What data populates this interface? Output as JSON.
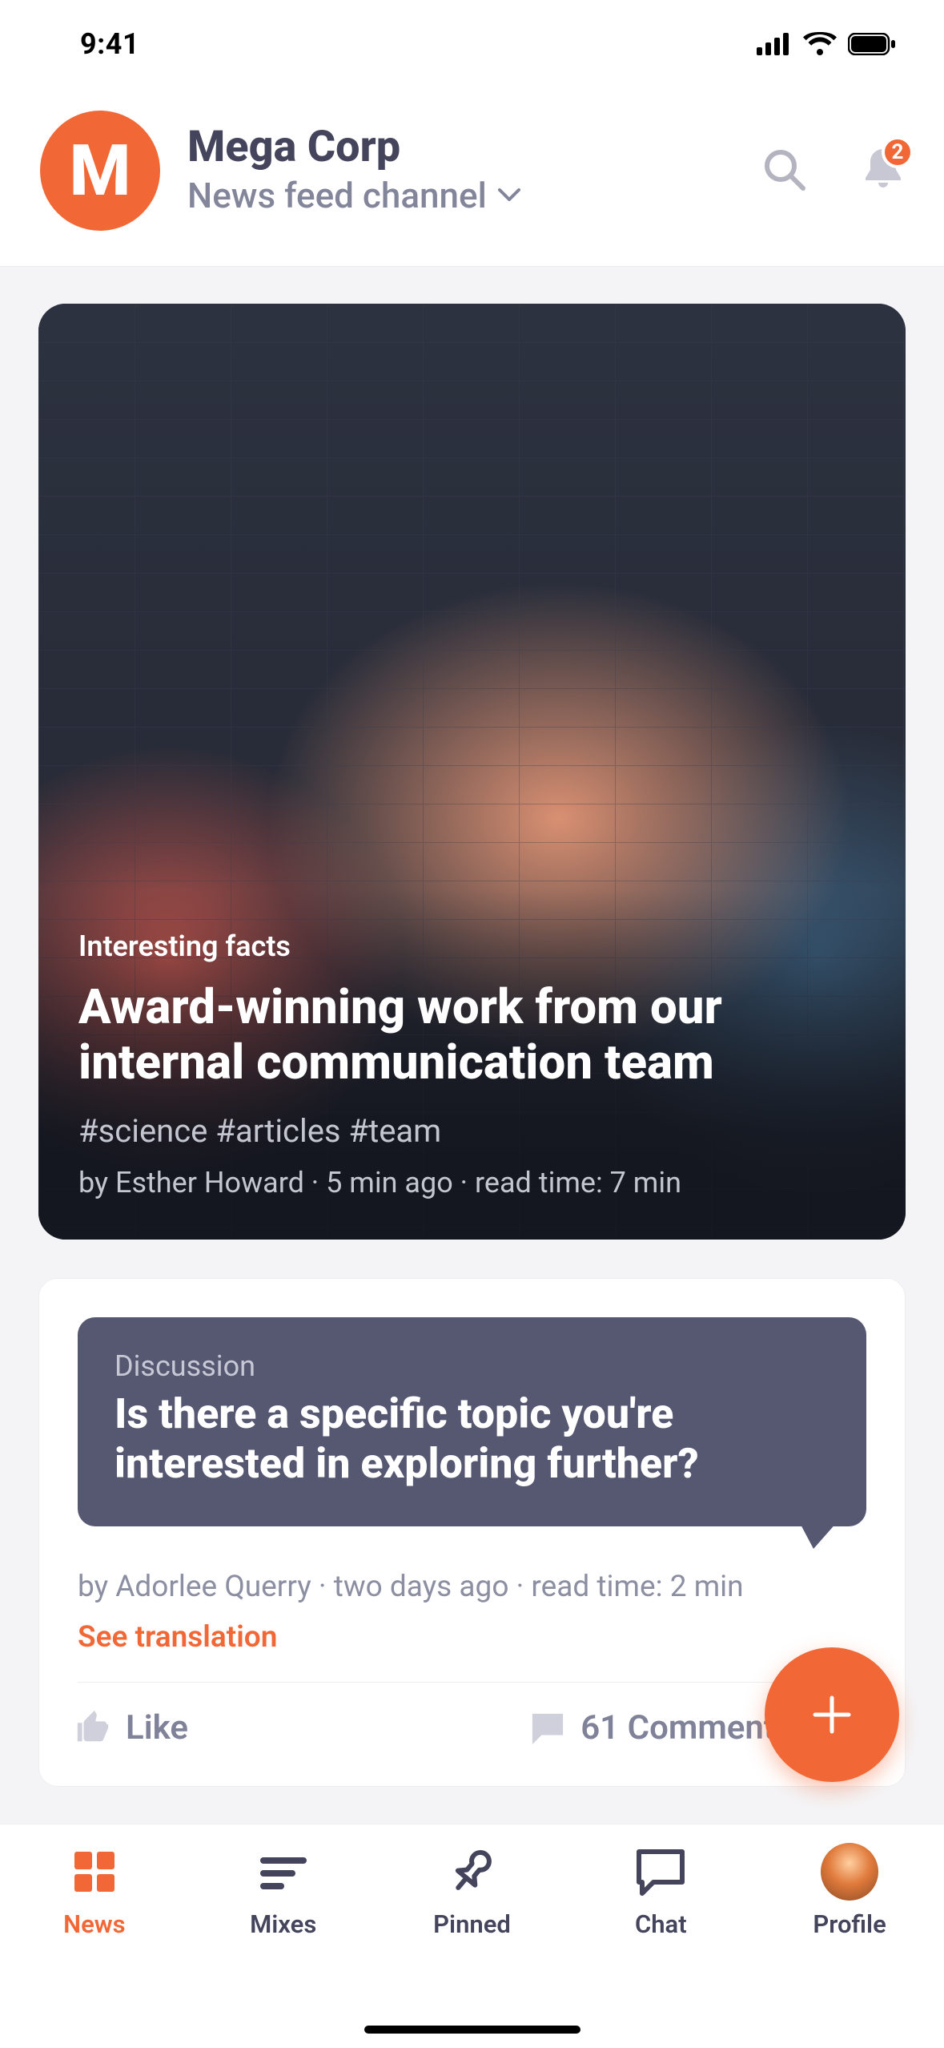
{
  "status": {
    "time": "9:41"
  },
  "header": {
    "logo_letter": "M",
    "title": "Mega Corp",
    "subtitle": "News feed channel",
    "badge_count": "2"
  },
  "hero": {
    "kicker": "Interesting facts",
    "title": "Award-winning work from our internal communication team",
    "tags": "#science #articles #team",
    "meta": "by Esther Howard · 5 min ago · read time: 7 min"
  },
  "discussion": {
    "kicker": "Discussion",
    "title": "Is there a specific topic you're interested in exploring further?",
    "meta": "by Adorlee Querry · two days ago · read time: 2 min",
    "translate": "See translation",
    "like_label": "Like",
    "comments_label": "61 Comments"
  },
  "nav": {
    "items": [
      {
        "label": "News"
      },
      {
        "label": "Mixes"
      },
      {
        "label": "Pinned"
      },
      {
        "label": "Chat"
      },
      {
        "label": "Profile"
      }
    ]
  }
}
